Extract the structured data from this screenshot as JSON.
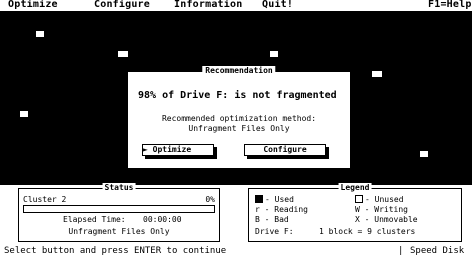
{
  "menu": {
    "items": [
      "Optimize",
      "Configure",
      "Information",
      "Quit!"
    ],
    "help": "F1=Help"
  },
  "dialog": {
    "title": "Recommendation",
    "heading": "98% of Drive F: is not fragmented",
    "method_label": "Recommended optimization method:",
    "method_value": "Unfragment Files Only",
    "optimize_label": "Optimize",
    "configure_label": "Configure"
  },
  "status_panel": {
    "title": "Status",
    "cluster_label": "Cluster 2",
    "percent": "0%",
    "elapsed_label": "Elapsed Time:",
    "elapsed_value": "00:00:00",
    "mode": "Unfragment Files Only"
  },
  "legend_panel": {
    "title": "Legend",
    "items": [
      {
        "key": "- Used",
        "desc": "- Unused"
      },
      {
        "key": "r - Reading",
        "desc": "W - Writing"
      },
      {
        "key": "B - Bad",
        "desc": "X - Unmovable"
      }
    ],
    "drive_label": "Drive F:",
    "block_text": "1 block = 9 clusters"
  },
  "statusbar": {
    "left": "Select button and press ENTER to continue",
    "right": "Speed Disk"
  },
  "colors": {
    "background": "#ffffff",
    "ink": "#000000",
    "gray": "#bdbdbd"
  }
}
